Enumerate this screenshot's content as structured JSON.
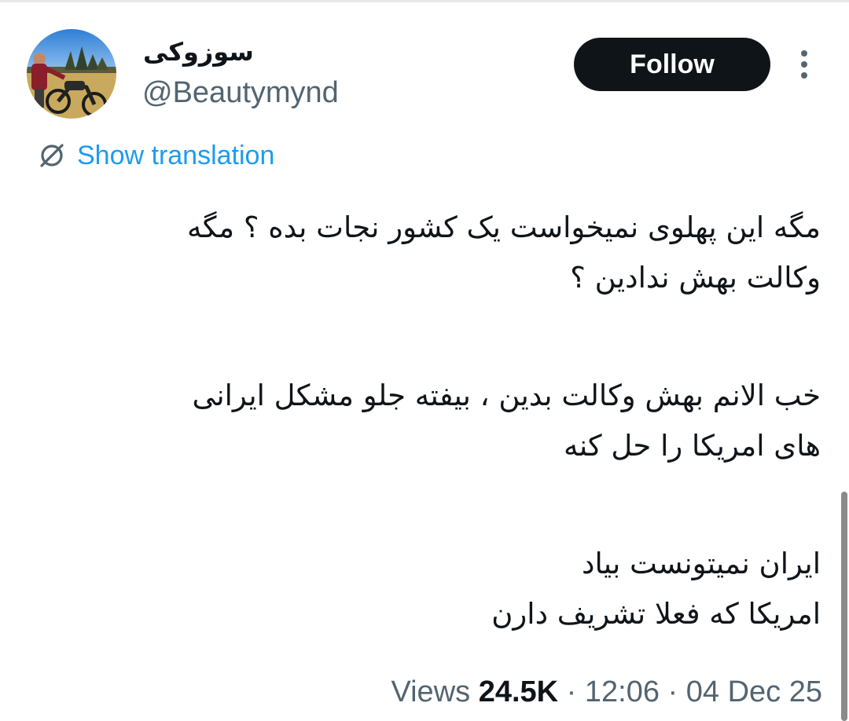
{
  "author": {
    "display_name": "سوزوکی",
    "handle": "@Beautymynd"
  },
  "follow_button": {
    "label": "Follow"
  },
  "more_menu": {
    "icon": "more-vertical-icon"
  },
  "translation": {
    "icon": "translate-slash-icon",
    "label": "Show translation",
    "color": "#1d9bf0"
  },
  "tweet": {
    "paragraphs": [
      [
        "مگه این پهلوی نمیخواست یک کشور نجات بده ؟ مگه",
        "وکالت بهش ندادین ؟"
      ],
      [
        "خب الانم بهش وکالت بدین ، بیفته جلو مشکل ایرانی",
        "های امریکا را حل کنه"
      ],
      [
        "ایران نمیتونست بیاد",
        "امریکا که فعلا تشریف دارن"
      ]
    ]
  },
  "meta": {
    "views_label": "Views",
    "views_count": "24.5K",
    "separator": "·",
    "time": "12:06",
    "date": "04 Dec 25"
  },
  "colors": {
    "text_primary": "#0f1419",
    "text_secondary": "#536471",
    "follow_bg": "#0f1419",
    "link": "#1d9bf0"
  }
}
